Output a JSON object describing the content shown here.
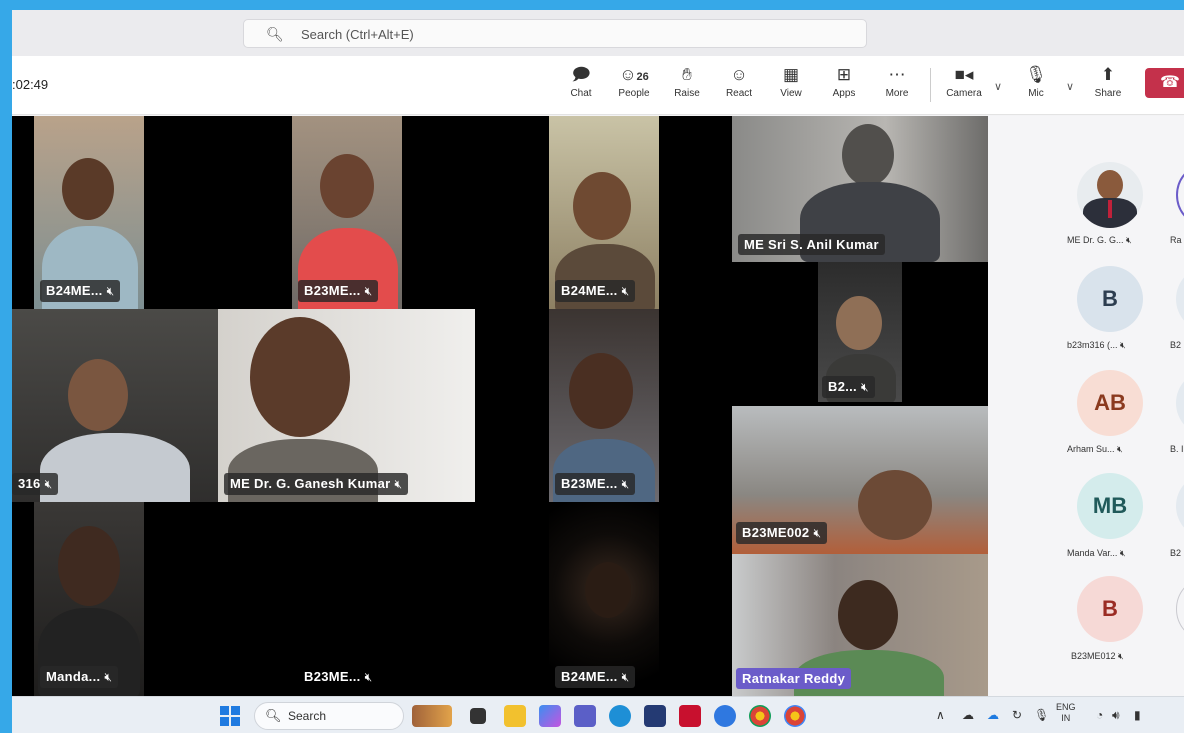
{
  "search": {
    "placeholder": "Search (Ctrl+Alt+E)"
  },
  "meeting": {
    "timer": ":02:49"
  },
  "toolbar": {
    "chat": "Chat",
    "people": "People",
    "people_count": "26",
    "raise": "Raise",
    "react": "React",
    "view": "View",
    "apps": "Apps",
    "more": "More",
    "camera": "Camera",
    "mic": "Mic",
    "share": "Share"
  },
  "tiles": [
    {
      "label": "B24ME...",
      "muted": "mic-off"
    },
    {
      "label": "B23ME...",
      "muted": "mic-off"
    },
    {
      "label": "B24ME...",
      "muted": "mic-off"
    },
    {
      "label": "ME Sri S. Anil Kumar"
    },
    {
      "label": "B2...",
      "muted": "mic-off"
    },
    {
      "label": "316",
      "muted": "mic-off"
    },
    {
      "label": "ME Dr. G. Ganesh Kumar",
      "muted": "mic-off"
    },
    {
      "label": "B23ME...",
      "muted": "mic-off"
    },
    {
      "label": "B23ME002",
      "muted": "mic-off"
    },
    {
      "label": "Manda...",
      "muted": "mic-off"
    },
    {
      "label": "B23ME...",
      "muted": "mic-off"
    },
    {
      "label": "B24ME...",
      "muted": "mic-off"
    },
    {
      "label": "Ratnakar Reddy"
    }
  ],
  "roster": [
    {
      "name": "ME Dr. G. G...",
      "initials": "",
      "kind": "photo"
    },
    {
      "name": "Ra",
      "initials": "",
      "kind": "ring"
    },
    {
      "name": "b23m316 (...",
      "initials": "B",
      "bg": "#d9e3ec",
      "fg": "#2d3e50"
    },
    {
      "name": "B2",
      "initials": "",
      "bg": "#e4eaf0"
    },
    {
      "name": "Arham Su...",
      "initials": "AB",
      "bg": "#f8ddd4",
      "fg": "#8b3a1f"
    },
    {
      "name": "B. I",
      "initials": "",
      "bg": "#e4eaf0"
    },
    {
      "name": "Manda Var...",
      "initials": "MB",
      "bg": "#d4ecec",
      "fg": "#205a5a"
    },
    {
      "name": "B2",
      "initials": "",
      "bg": "#e4eaf0"
    },
    {
      "name": "B23ME012",
      "initials": "B",
      "bg": "#f6d9d6",
      "fg": "#9b2c24"
    },
    {
      "name": "",
      "initials": "",
      "kind": "ring"
    }
  ],
  "taskbar": {
    "search_placeholder": "Search",
    "lang": "ENG",
    "region": "IN"
  }
}
